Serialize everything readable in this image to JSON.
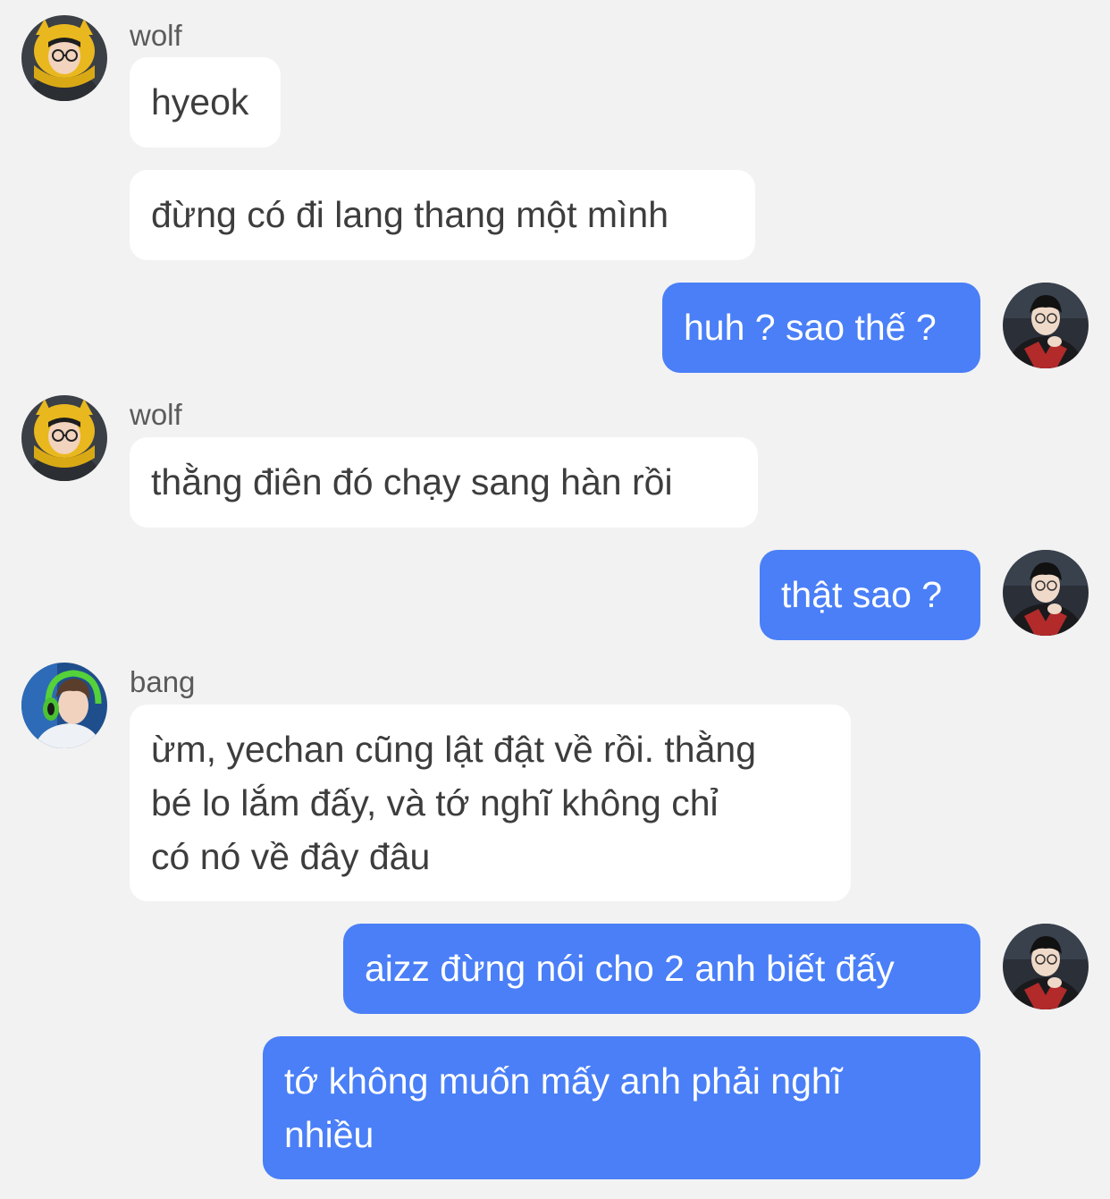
{
  "conversation": {
    "messages": [
      {
        "sender": "wolf",
        "text": "hyeok"
      },
      {
        "sender": "wolf",
        "text": "đừng có đi lang thang một mình"
      },
      {
        "sender": "me",
        "text": "huh ? sao thế ?"
      },
      {
        "sender": "wolf",
        "text": "thằng điên đó chạy sang hàn rồi"
      },
      {
        "sender": "me",
        "text": "thật sao ?"
      },
      {
        "sender": "bang",
        "text": "ừm, yechan cũng lật đật về rồi. thằng\nbé lo lắm đấy, và tớ nghĩ không chỉ\ncó nó về đây đâu"
      },
      {
        "sender": "me",
        "text": "aizz đừng nói cho 2 anh biết đấy"
      },
      {
        "sender": "me",
        "text": "tớ không muốn mấy anh phải nghĩ\nnhiều"
      }
    ],
    "sender_names": {
      "wolf_1": "wolf",
      "wolf_2": "wolf",
      "bang": "bang"
    }
  },
  "colors": {
    "background": "#f2f2f2",
    "incoming_bubble": "#ffffff",
    "outgoing_bubble": "#4a7ff7",
    "outgoing_text": "#ffffff"
  }
}
